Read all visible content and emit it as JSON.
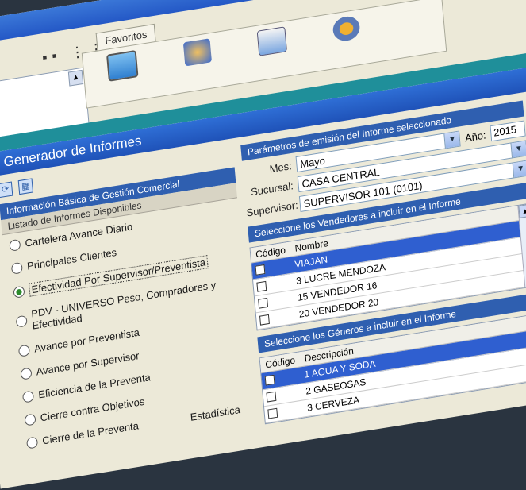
{
  "back_window": {
    "favorites_tab": "Favoritos",
    "window_buttons": [
      "_",
      "□",
      "X"
    ]
  },
  "dialog": {
    "title": "Generador de Informes",
    "left": {
      "group_header": "Información Básica de Gestión Comercial",
      "sub_header": "Listado de Informes Disponibles",
      "reports": [
        {
          "label": "Cartelera Avance Diario",
          "selected": false
        },
        {
          "label": "Principales Clientes",
          "selected": false
        },
        {
          "label": "Efectividad Por Supervisor/Preventista",
          "selected": true
        },
        {
          "label": "PDV - UNIVERSO Peso, Compradores y Efectividad",
          "selected": false
        },
        {
          "label": "Avance por Preventista",
          "selected": false
        },
        {
          "label": "Avance por Supervisor",
          "selected": false
        },
        {
          "label": "Eficiencia de la Preventa",
          "selected": false
        },
        {
          "label": "Cierre contra Objetivos",
          "selected": false
        },
        {
          "label": "Cierre de la Preventa",
          "selected": false
        }
      ],
      "extra_text": "Estadística"
    },
    "right": {
      "params_header": "Parámetros de emisión del Informe seleccionado",
      "mes_label": "Mes:",
      "mes_value": "Mayo",
      "anio_label": "Año:",
      "anio_value": "2015",
      "sucursal_label": "Sucursal:",
      "sucursal_value": "CASA CENTRAL",
      "supervisor_label": "Supervisor:",
      "supervisor_value": "SUPERVISOR 101 (0101)",
      "vendedores_header": "Seleccione los Vendedores a incluir en el Informe",
      "vendedores_cols": [
        "Código",
        "Nombre"
      ],
      "vendedores_rows": [
        {
          "name": "VIAJAN",
          "selected": true
        },
        {
          "name": "3 LUCRE MENDOZA",
          "selected": false
        },
        {
          "name": "15 VENDEDOR 16",
          "selected": false
        },
        {
          "name": "20 VENDEDOR 20",
          "selected": false
        }
      ],
      "generos_header": "Seleccione los Géneros a incluir en el Informe",
      "generos_cols": [
        "Código",
        "Descripción"
      ],
      "generos_rows": [
        {
          "name": "1 AGUA Y SODA",
          "selected": true
        },
        {
          "name": "2 GASEOSAS",
          "selected": false
        },
        {
          "name": "3 CERVEZA",
          "selected": false
        }
      ]
    }
  },
  "colors": {
    "title_blue": "#1f52b8",
    "teal": "#1f8f9a",
    "selection_blue": "#2f5fd0"
  }
}
